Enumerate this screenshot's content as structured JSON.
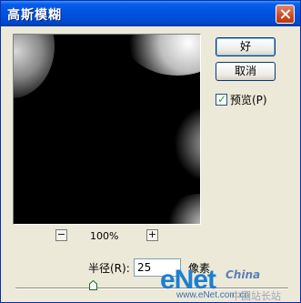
{
  "window": {
    "title": "高斯模糊"
  },
  "buttons": {
    "ok": "好",
    "cancel": "取消"
  },
  "preview_option": {
    "label": "预览(P)",
    "checked": true
  },
  "zoom": {
    "minus": "−",
    "plus": "+",
    "level": "100%"
  },
  "radius": {
    "label": "半径(R):",
    "value": "25",
    "unit": "像素"
  },
  "slider": {
    "value": 25
  },
  "watermark": {
    "main": "eNet",
    "brand": "China",
    "url": "www.eNet.com.cn",
    "cn": "中国站长站"
  },
  "colors": {
    "titlebar": "#0053e1",
    "dialog_bg": "#ece9d8",
    "preview_bg": "#000000",
    "close_button": "#cc4a23"
  }
}
